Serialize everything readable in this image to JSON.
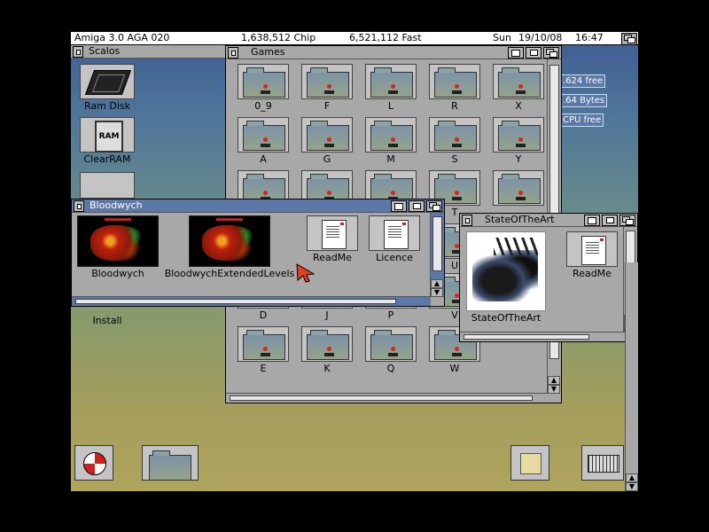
{
  "screen": {
    "os": "Amiga 3.0 AGA 020",
    "chip": "1,638,512 Chip",
    "fast": "6,521,112 Fast",
    "day": "Sun",
    "date": "19/10/08",
    "time": "16:47"
  },
  "scalos": {
    "title": "Scalos",
    "icons": [
      {
        "label": "Ram Disk",
        "icon": "chip-icon"
      },
      {
        "label": "ClearRAM",
        "icon": "ram-chip-icon"
      },
      {
        "label": "Install",
        "icon": "install-icon"
      }
    ]
  },
  "background_tags": [
    ".624 free",
    ".64 Bytes",
    "CPU free"
  ],
  "games": {
    "title": "Games",
    "rows": [
      [
        "0_9",
        "F",
        "L",
        "R",
        "X"
      ],
      [
        "A",
        "G",
        "M",
        "S",
        "Y"
      ],
      [
        "",
        "",
        "",
        "T",
        ""
      ],
      [
        "",
        "",
        "",
        "U",
        ""
      ],
      [
        "D",
        "J",
        "P",
        "V",
        ""
      ],
      [
        "E",
        "K",
        "Q",
        "W",
        ""
      ]
    ]
  },
  "bloodwych": {
    "title": "Bloodwych",
    "icons": [
      {
        "label": "Bloodwych",
        "type": "game"
      },
      {
        "label": "BloodwychExtendedLevels",
        "type": "game"
      },
      {
        "label": "ReadMe",
        "type": "document"
      },
      {
        "label": "Licence",
        "type": "document"
      }
    ]
  },
  "stateoftheart": {
    "title": "StateOfTheArt",
    "icons": [
      {
        "label": "StateOfTheArt",
        "type": "image"
      },
      {
        "label": "ReadMe",
        "type": "document"
      }
    ]
  },
  "colors": {
    "active_title": "#5c78a8",
    "window_bg": "#a8a8a8"
  }
}
